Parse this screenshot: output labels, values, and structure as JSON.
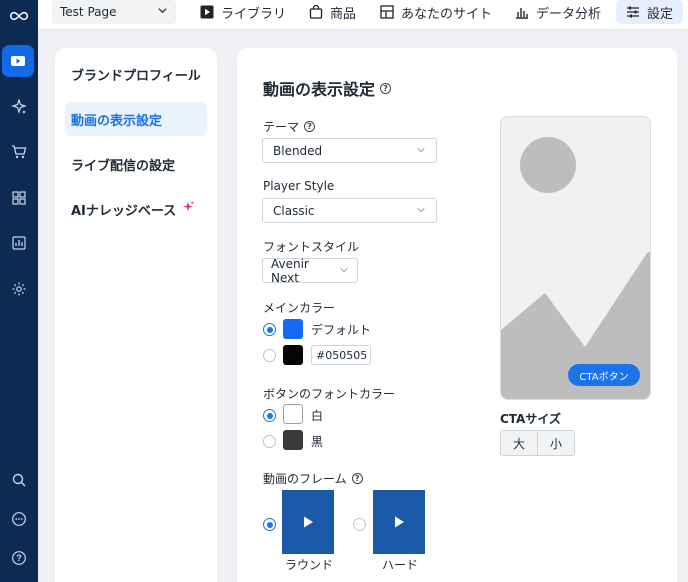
{
  "topbar": {
    "page_select": "Test Page",
    "nav": [
      "ライブラリ",
      "商品",
      "あなたのサイト",
      "データ分析",
      "設定"
    ]
  },
  "submenu": {
    "items": [
      "ブランドプロフィール",
      "動画の表示設定",
      "ライブ配信の設定",
      "AIナレッジベース"
    ],
    "selected": "動画の表示設定"
  },
  "main": {
    "title": "動画の表示設定",
    "theme": {
      "label": "テーマ",
      "value": "Blended"
    },
    "player_style": {
      "label": "Player Style",
      "value": "Classic"
    },
    "font_style": {
      "label": "フォントスタイル",
      "value": "Avenir Next"
    },
    "main_color": {
      "label": "メインカラー",
      "options": [
        {
          "text": "デフォルト",
          "color": "#1469f5",
          "selected": true
        },
        {
          "text": "#050505",
          "color": "#050505",
          "selected": false
        }
      ]
    },
    "button_font_color": {
      "label": "ボタンのフォントカラー",
      "options": [
        {
          "text": "白",
          "color": "#ffffff",
          "selected": true
        },
        {
          "text": "黒",
          "color": "#3a3a3a",
          "selected": false
        }
      ]
    },
    "frame": {
      "label": "動画のフレーム",
      "options": [
        {
          "text": "ラウンド",
          "selected": true
        },
        {
          "text": "ハード",
          "selected": false
        }
      ]
    },
    "preview": {
      "cta_label": "CTAボタン"
    },
    "cta_size": {
      "label": "CTAサイズ",
      "options": [
        "大",
        "小"
      ]
    }
  },
  "colors": {
    "accent": "#1a73e8",
    "rail": "#0d2a52",
    "frame": "#1a5aa8"
  }
}
